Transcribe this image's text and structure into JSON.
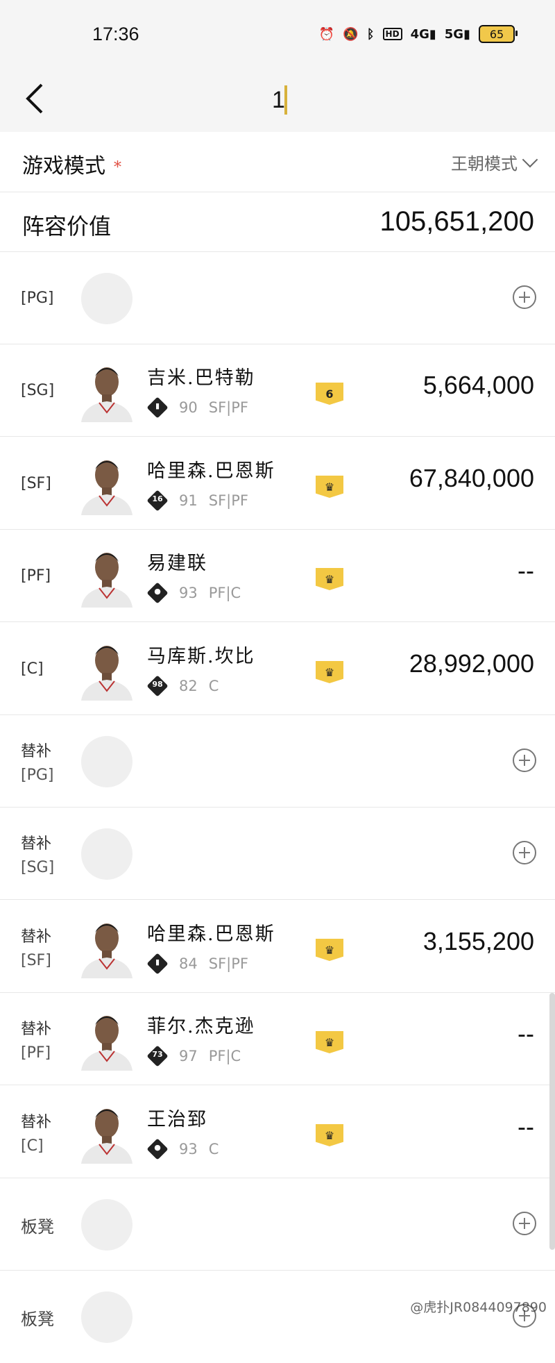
{
  "status_bar": {
    "time": "17:36",
    "icons": [
      "alarm-icon",
      "mute-icon",
      "bluetooth-icon",
      "hd-icon",
      "signal-4g-icon",
      "signal-5g-icon"
    ],
    "battery": "65"
  },
  "nav": {
    "title": "1"
  },
  "mode": {
    "label": "游戏模式",
    "required": "*",
    "value": "王朝模式"
  },
  "roster_value": {
    "label": "阵容价值",
    "value": "105,651,200"
  },
  "slots": [
    {
      "pos": "[PG]",
      "sub": "",
      "empty": true
    },
    {
      "pos": "[SG]",
      "sub": "",
      "name": "吉米.巴特勒",
      "icon": "chart",
      "rating": "90",
      "positions": "SF|PF",
      "badge": "6",
      "salary": "5,664,000"
    },
    {
      "pos": "[SF]",
      "sub": "",
      "name": "哈里森.巴恩斯",
      "icon": "16",
      "rating": "91",
      "positions": "SF|PF",
      "badge": "crown",
      "salary": "67,840,000"
    },
    {
      "pos": "[PF]",
      "sub": "",
      "name": "易建联",
      "icon": "person",
      "rating": "93",
      "positions": "PF|C",
      "badge": "crown",
      "salary": "--"
    },
    {
      "pos": "[C]",
      "sub": "",
      "name": "马库斯.坎比",
      "icon": "98",
      "rating": "82",
      "positions": "C",
      "badge": "crown",
      "salary": "28,992,000"
    },
    {
      "pos": "替补",
      "sub": "[PG]",
      "empty": true
    },
    {
      "pos": "替补",
      "sub": "[SG]",
      "empty": true
    },
    {
      "pos": "替补",
      "sub": "[SF]",
      "name": "哈里森.巴恩斯",
      "icon": "chart",
      "rating": "84",
      "positions": "SF|PF",
      "badge": "crown",
      "salary": "3,155,200"
    },
    {
      "pos": "替补",
      "sub": "[PF]",
      "name": "菲尔.杰克逊",
      "icon": "73",
      "rating": "97",
      "positions": "PF|C",
      "badge": "crown",
      "salary": "--"
    },
    {
      "pos": "替补",
      "sub": "[C]",
      "name": "王治郅",
      "icon": "person",
      "rating": "93",
      "positions": "C",
      "badge": "crown",
      "salary": "--"
    }
  ],
  "bench": [
    {
      "label": "板凳"
    },
    {
      "label": "板凳"
    }
  ],
  "watermark": "@虎扑JR0844097890"
}
